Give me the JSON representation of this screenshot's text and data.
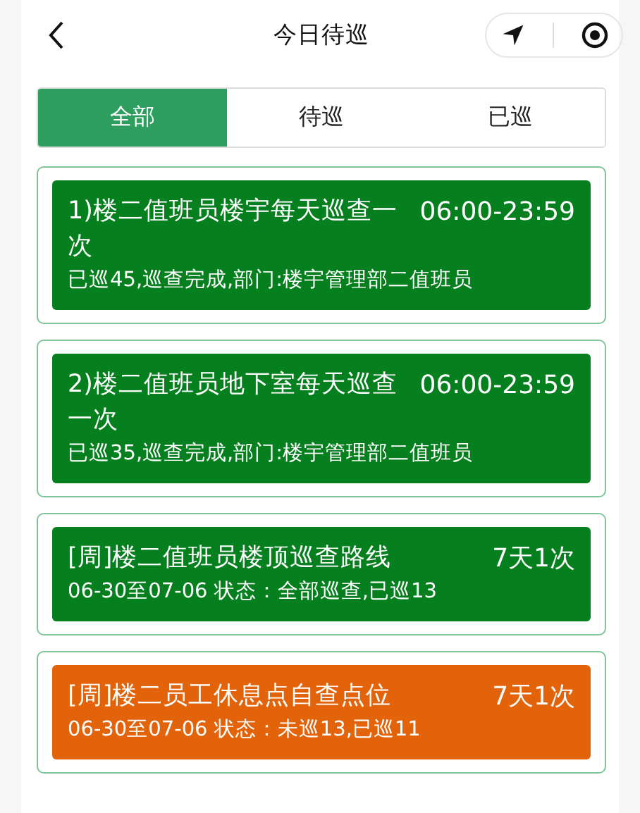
{
  "header": {
    "title": "今日待巡"
  },
  "tabs": [
    {
      "label": "全部",
      "selected": true
    },
    {
      "label": "待巡",
      "selected": false
    },
    {
      "label": "已巡",
      "selected": false
    }
  ],
  "tasks": [
    {
      "title": "1)楼二值班员楼宇每天巡查一次",
      "time": "06:00-23:59",
      "detail": "已巡45,巡查完成,部门:楼宇管理部二值班员",
      "color": "#067f1f"
    },
    {
      "title": "2)楼二值班员地下室每天巡查一次",
      "time": "06:00-23:59",
      "detail": "已巡35,巡查完成,部门:楼宇管理部二值班员",
      "color": "#067f1f"
    },
    {
      "title": "[周]楼二值班员楼顶巡查路线",
      "time": "7天1次",
      "detail": "06-30至07-06 状态：全部巡查,已巡13",
      "color": "#067f1f"
    },
    {
      "title": "[周]楼二员工休息点自查点位",
      "time": "7天1次",
      "detail": "06-30至07-06 状态：未巡13,已巡11",
      "color": "#e2630a"
    }
  ]
}
